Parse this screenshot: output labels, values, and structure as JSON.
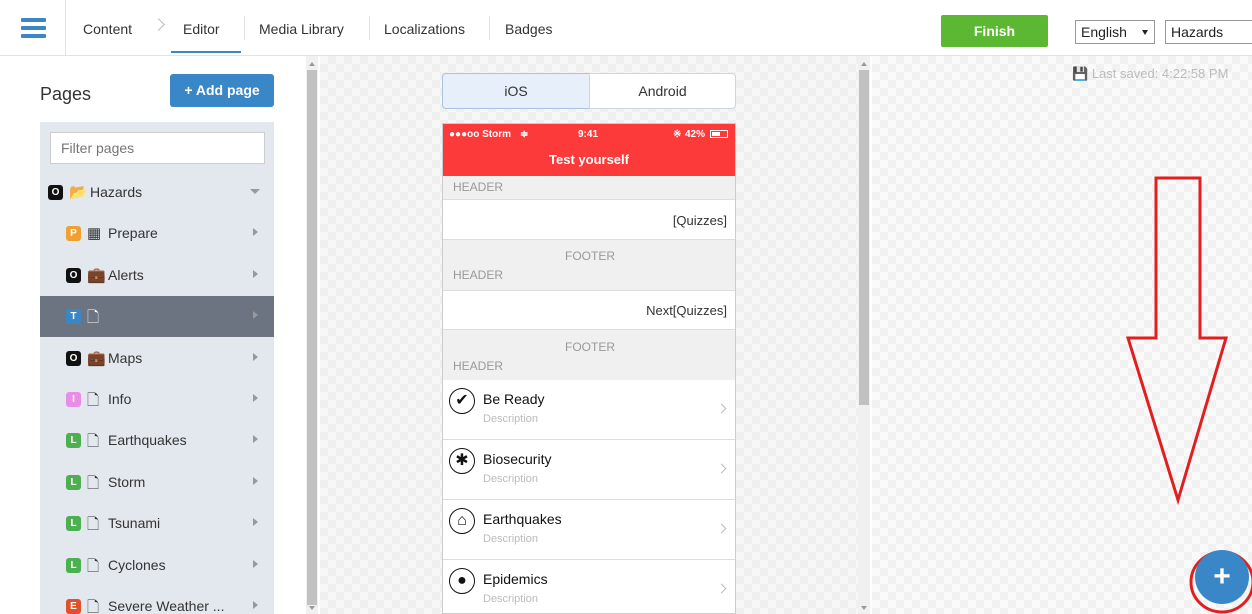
{
  "nav": {
    "tabs": [
      "Content",
      "Editor",
      "Media Library",
      "Localizations",
      "Badges"
    ],
    "finish_label": "Finish",
    "language": "English",
    "app": "Hazards"
  },
  "left": {
    "title": "Pages",
    "add_page": "+ Add page",
    "filter_placeholder": "Filter pages",
    "items": [
      {
        "badge": "O",
        "badge_color": "#111111",
        "icon": "folder-open-icon",
        "label": "Hazards",
        "expanded": true,
        "selected": false
      },
      {
        "badge": "P",
        "badge_color": "#f0a030",
        "icon": "grid-icon",
        "label": "Prepare",
        "expanded": false,
        "selected": false
      },
      {
        "badge": "O",
        "badge_color": "#111111",
        "icon": "briefcase-icon",
        "label": "Alerts",
        "expanded": false,
        "selected": false
      },
      {
        "badge": "T",
        "badge_color": "#3a87c8",
        "icon": "file-icon",
        "label": "",
        "expanded": false,
        "selected": true
      },
      {
        "badge": "O",
        "badge_color": "#111111",
        "icon": "briefcase-icon",
        "label": "Maps",
        "expanded": false,
        "selected": false
      },
      {
        "badge": "I",
        "badge_color": "#e98ee8",
        "icon": "file-icon",
        "label": "Info",
        "expanded": false,
        "selected": false
      },
      {
        "badge": "L",
        "badge_color": "#4caf50",
        "icon": "file-icon",
        "label": "Earthquakes",
        "expanded": false,
        "selected": false
      },
      {
        "badge": "L",
        "badge_color": "#4caf50",
        "icon": "file-icon",
        "label": "Storm",
        "expanded": false,
        "selected": false
      },
      {
        "badge": "L",
        "badge_color": "#4caf50",
        "icon": "file-icon",
        "label": "Tsunami",
        "expanded": false,
        "selected": false
      },
      {
        "badge": "L",
        "badge_color": "#4caf50",
        "icon": "file-icon",
        "label": "Cyclones",
        "expanded": false,
        "selected": false
      },
      {
        "badge": "E",
        "badge_color": "#e0502a",
        "icon": "file-icon",
        "label": "Severe Weather ...",
        "expanded": false,
        "selected": false
      }
    ]
  },
  "preview": {
    "platforms": [
      "iOS",
      "Android"
    ],
    "active_platform": "iOS",
    "status": {
      "carrier": "●●●oo Storm",
      "time": "9:41",
      "battery": "42%"
    },
    "page_title": "Test yourself",
    "header_label": "HEADER",
    "footer_label": "FOOTER",
    "quiz_cell_1": "[Quizzes]",
    "quiz_cell_2": "Next[Quizzes]",
    "items": [
      {
        "icon": "checkmark-icon",
        "title": "Be Ready",
        "desc": "Description"
      },
      {
        "icon": "bug-icon",
        "title": "Biosecurity",
        "desc": "Description"
      },
      {
        "icon": "house-quake-icon",
        "title": "Earthquakes",
        "desc": "Description"
      },
      {
        "icon": "head-icon",
        "title": "Epidemics",
        "desc": "Description"
      }
    ]
  },
  "last_saved": "Last saved: 4:22:58 PM",
  "colors": {
    "accent": "#3a87c8",
    "finish": "#5cb832",
    "statusbar": "#fc3a3a",
    "annotation": "#e02020"
  }
}
